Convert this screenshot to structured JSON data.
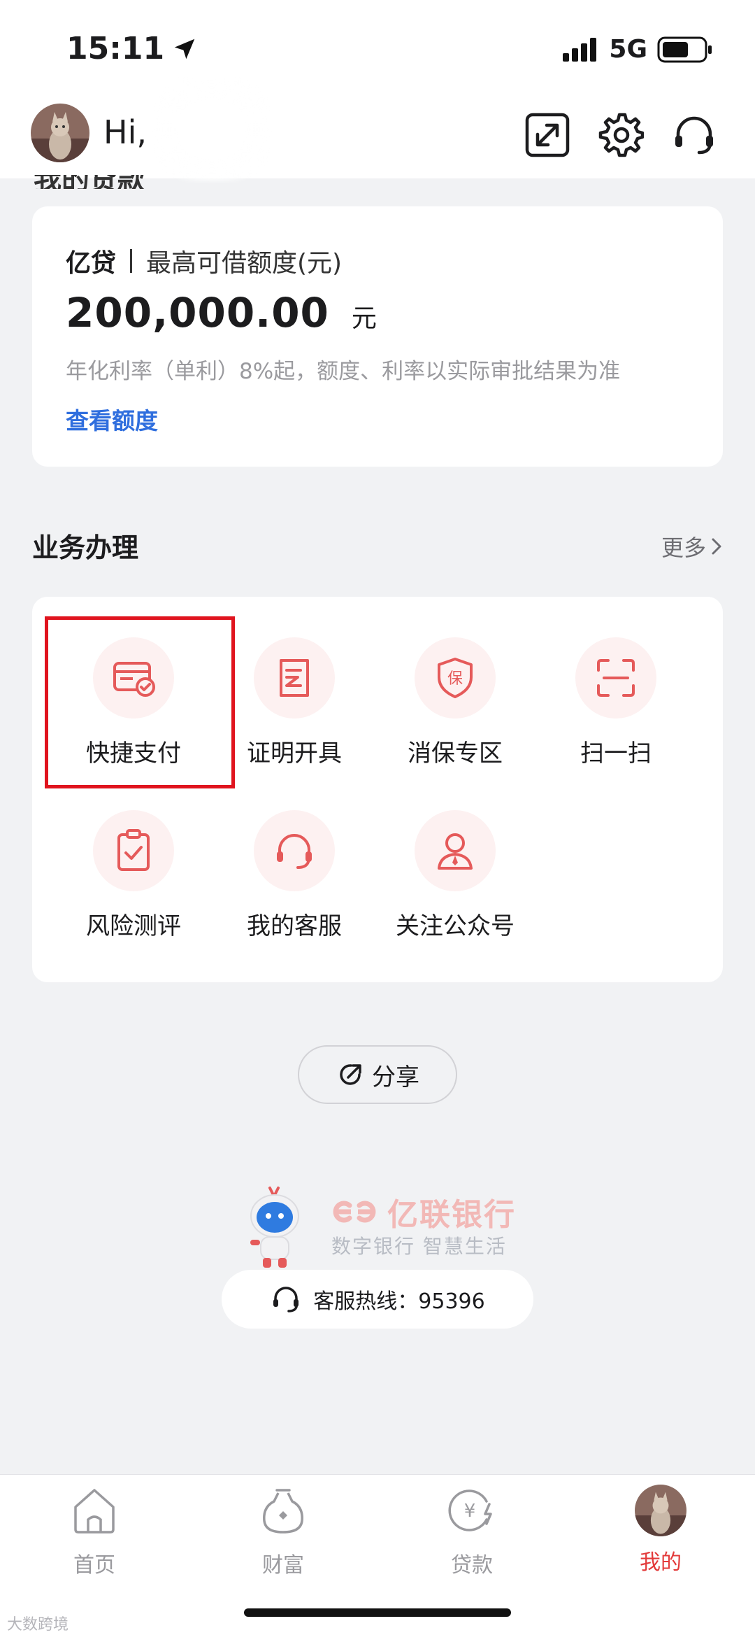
{
  "status_bar": {
    "time": "15:11",
    "network": "5G"
  },
  "header": {
    "greeting": "Hi,",
    "icons": [
      "expand-icon",
      "gear-icon",
      "headset-icon"
    ]
  },
  "partial_section_title": "我的贷款",
  "loan_card": {
    "product": "亿贷",
    "limit_label": "最高可借额度(元)",
    "amount": "200,000.00",
    "unit": "元",
    "note": "年化利率（单利）8%起，额度、利率以实际审批结果为准",
    "link": "查看额度"
  },
  "services": {
    "title": "业务办理",
    "more": "更多",
    "items": [
      {
        "label": "快捷支付",
        "icon": "card-check-icon"
      },
      {
        "label": "证明开具",
        "icon": "document-icon"
      },
      {
        "label": "消保专区",
        "icon": "shield-bao-icon"
      },
      {
        "label": "扫一扫",
        "icon": "scan-icon"
      },
      {
        "label": "风险测评",
        "icon": "clipboard-check-icon"
      },
      {
        "label": "我的客服",
        "icon": "headset-icon"
      },
      {
        "label": "关注公众号",
        "icon": "person-icon"
      }
    ]
  },
  "share": {
    "label": "分享"
  },
  "brand": {
    "name": "亿联银行",
    "slogan": "数字银行 智慧生活",
    "hotline": "客服热线：95396"
  },
  "tabs": [
    {
      "label": "首页",
      "icon": "home-icon",
      "active": false
    },
    {
      "label": "财富",
      "icon": "wealth-bag-icon",
      "active": false
    },
    {
      "label": "贷款",
      "icon": "loan-yen-icon",
      "active": false
    },
    {
      "label": "我的",
      "icon": "avatar",
      "active": true
    }
  ],
  "watermark": "大数跨境",
  "colors": {
    "accent_red": "#e33a3a",
    "highlight_red": "#e0141e",
    "link_blue": "#2f6ede",
    "background": "#f1f2f4"
  }
}
